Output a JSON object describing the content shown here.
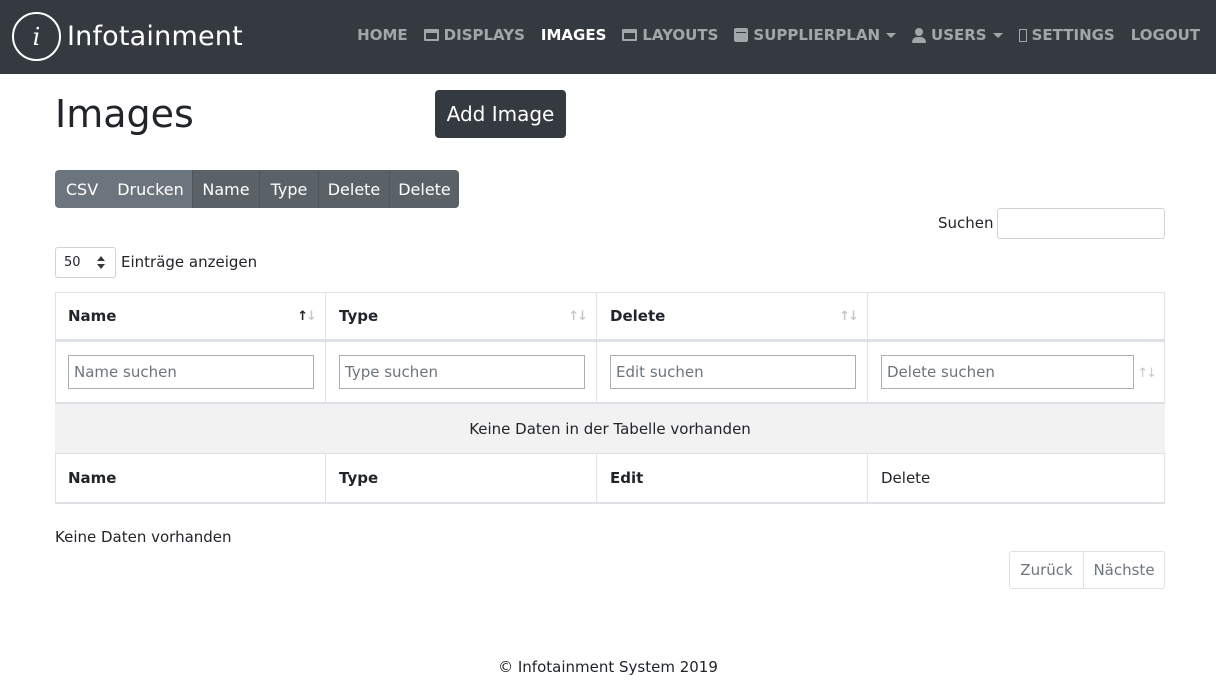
{
  "navbar": {
    "brand_logo_letter": "i",
    "brand_name": "Infotainment",
    "items": [
      {
        "label": "HOME",
        "icon": "",
        "active": false,
        "dropdown": false
      },
      {
        "label": "DISPLAYS",
        "icon": "window-icon",
        "active": false,
        "dropdown": false
      },
      {
        "label": "IMAGES",
        "icon": "",
        "active": true,
        "dropdown": false
      },
      {
        "label": "LAYOUTS",
        "icon": "window-icon",
        "active": false,
        "dropdown": false
      },
      {
        "label": "SUPPLIERPLAN",
        "icon": "calendar-icon",
        "active": false,
        "dropdown": true
      },
      {
        "label": "USERS",
        "icon": "user-icon",
        "active": false,
        "dropdown": true
      },
      {
        "label": "SETTINGS",
        "icon": "settings-icon",
        "active": false,
        "dropdown": false
      },
      {
        "label": "LOGOUT",
        "icon": "",
        "active": false,
        "dropdown": false
      }
    ]
  },
  "page": {
    "title": "Images",
    "add_button": "Add Image"
  },
  "toolbar": {
    "buttons": [
      "CSV",
      "Drucken",
      "Name",
      "Type",
      "Delete",
      "Delete"
    ]
  },
  "search": {
    "label": "Suchen",
    "value": ""
  },
  "length": {
    "selected": "50",
    "label": "Einträge anzeigen"
  },
  "table": {
    "headers": [
      "Name",
      "Type",
      "Delete"
    ],
    "filters": [
      "Name suchen",
      "Type suchen",
      "Edit suchen",
      "Delete suchen"
    ],
    "empty_message": "Keine Daten in der Tabelle vorhanden",
    "footers": [
      "Name",
      "Type",
      "Edit",
      "Delete"
    ]
  },
  "info": "Keine Daten vorhanden",
  "pagination": {
    "prev": "Zurück",
    "next": "Nächste"
  },
  "footer": "© Infotainment System 2019",
  "colors": {
    "navbar_bg": "#343a40",
    "button_secondary": "#6c757d",
    "button_dark": "#343a40"
  }
}
